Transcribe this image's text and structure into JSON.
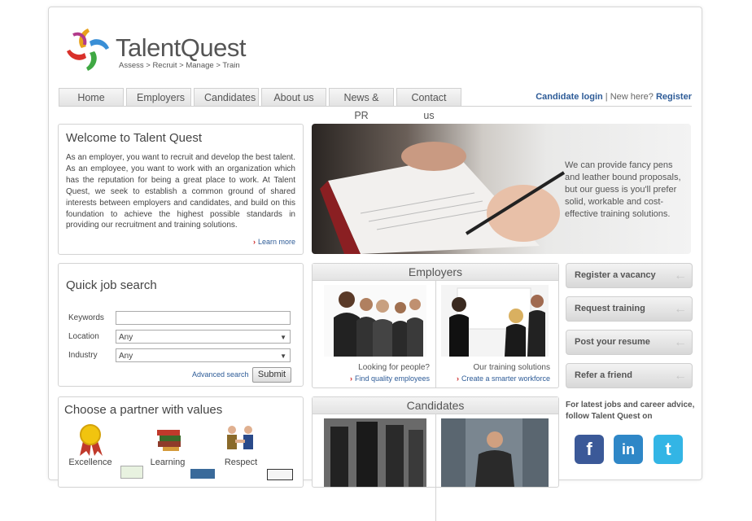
{
  "brand": {
    "name_part1": "Talent",
    "name_part2": "Quest",
    "tagline": "Assess > Recruit > Manage > Train"
  },
  "nav": {
    "tabs": [
      "Home",
      "Employers",
      "Candidates",
      "About us",
      "News & PR",
      "Contact us"
    ],
    "login_label": "Candidate login",
    "separator": " | New here? ",
    "register_label": "Register"
  },
  "welcome": {
    "title": "Welcome to Talent Quest",
    "body": "As an employer, you want to recruit and develop the best talent. As an employee, you want to work with an organization which has the reputation for being a great place to work. At Talent Quest, we seek to establish a common ground of shared interests between employers and candidates, and build on this foundation to achieve the highest possible standards in providing our recruitment and training solutions.",
    "learn_more": "Learn more"
  },
  "hero": {
    "text": "We can provide fancy pens and leather bound proposals, but our guess is you'll prefer solid, workable and cost-effective training solutions."
  },
  "quick_job_search": {
    "title": "Quick job search",
    "keywords_label": "Keywords",
    "keywords_value": "",
    "location_label": "Location",
    "location_value": "Any",
    "industry_label": "Industry",
    "industry_value": "Any",
    "advanced_search": "Advanced search",
    "submit": "Submit"
  },
  "employers": {
    "title": "Employers",
    "left_text": "Looking for people?",
    "left_link": "Find quality employees",
    "right_text": "Our training solutions",
    "right_link": "Create a smarter workforce"
  },
  "candidates": {
    "title": "Candidates"
  },
  "values": {
    "title": "Choose a partner with values",
    "items": [
      "Excellence",
      "Learning",
      "Respect"
    ]
  },
  "cta": {
    "buttons": [
      "Register a vacancy",
      "Request training",
      "Post your resume",
      "Refer a friend"
    ]
  },
  "social": {
    "follow_text": "For latest jobs and career advice, follow Talent Quest on",
    "icons": [
      "facebook-icon",
      "linkedin-icon",
      "twitter-icon"
    ]
  },
  "colors": {
    "link": "#2d5b97",
    "arrow": "#cc2222",
    "facebook": "#3b5998",
    "linkedin": "#2f87c7",
    "twitter": "#33b5e5"
  }
}
